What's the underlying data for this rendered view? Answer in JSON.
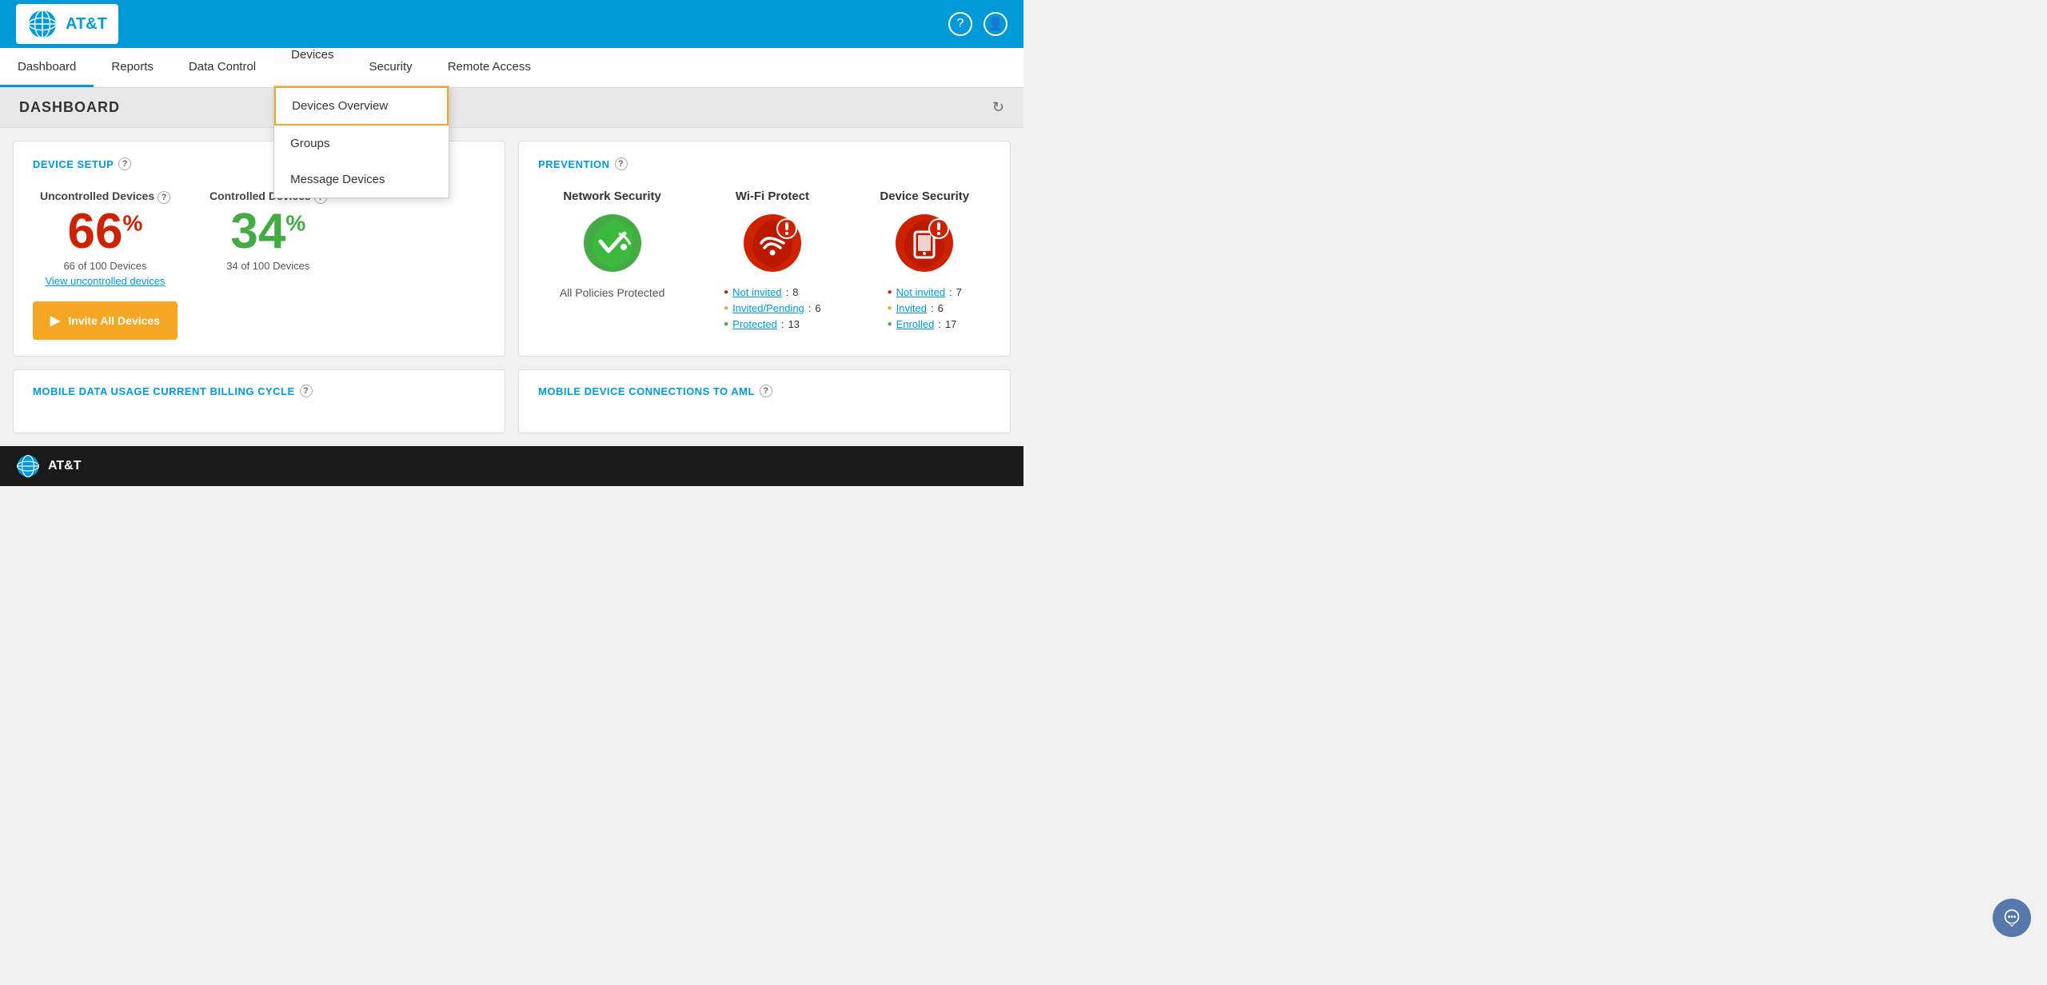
{
  "header": {
    "logo_text": "AT&T",
    "help_icon": "?",
    "user_icon": "👤"
  },
  "nav": {
    "items": [
      {
        "id": "dashboard",
        "label": "Dashboard",
        "active": true
      },
      {
        "id": "reports",
        "label": "Reports",
        "active": false
      },
      {
        "id": "data-control",
        "label": "Data Control",
        "active": false
      },
      {
        "id": "devices",
        "label": "Devices",
        "active": false,
        "open": true
      },
      {
        "id": "security",
        "label": "Security",
        "active": false
      },
      {
        "id": "remote-access",
        "label": "Remote Access",
        "active": false
      }
    ],
    "dropdown": {
      "items": [
        {
          "id": "devices-overview",
          "label": "Devices Overview",
          "highlighted": true
        },
        {
          "id": "groups",
          "label": "Groups"
        },
        {
          "id": "message-devices",
          "label": "Message Devices"
        }
      ]
    }
  },
  "page": {
    "title": "DASHBOARD",
    "refresh_icon": "↻"
  },
  "device_setup_card": {
    "title": "DEVICE SETUP",
    "help": "?",
    "uncontrolled": {
      "label": "Uncontrolled Devices",
      "help": "?",
      "percent": "66",
      "suffix": "%",
      "count": "66 of 100 Devices",
      "link": "View uncontrolled devices"
    },
    "controlled": {
      "label": "Controlled Devices",
      "help": "?",
      "percent": "34",
      "suffix": "%",
      "count": "34 of 100 Devices"
    },
    "invite_button": "Invite All Devices"
  },
  "prevention_card": {
    "title": "PREVENTION",
    "help": "?",
    "columns": [
      {
        "id": "network-security",
        "title": "Network Security",
        "icon_type": "shield-green",
        "status_text": "All Policies Protected",
        "stats": []
      },
      {
        "id": "wifi-protect",
        "title": "Wi-Fi Protect",
        "icon_type": "shield-red",
        "stats": [
          {
            "color": "red",
            "label": "Not invited",
            "value": "8"
          },
          {
            "color": "orange",
            "label": "Invited/Pending",
            "value": "6"
          },
          {
            "color": "green",
            "label": "Protected",
            "value": "13"
          }
        ]
      },
      {
        "id": "device-security",
        "title": "Device Security",
        "icon_type": "shield-red-device",
        "stats": [
          {
            "color": "red",
            "label": "Not invited",
            "value": "7"
          },
          {
            "color": "orange",
            "label": "Invited",
            "value": "6"
          },
          {
            "color": "green",
            "label": "Enrolled",
            "value": "17"
          }
        ]
      }
    ]
  },
  "bottom_cards": [
    {
      "id": "mobile-data",
      "title": "MOBILE DATA USAGE CURRENT BILLING CYCLE",
      "help": "?"
    },
    {
      "id": "mobile-device-connections",
      "title": "MOBILE DEVICE CONNECTIONS TO AML",
      "help": "?"
    }
  ],
  "footer": {
    "logo_text": "AT&T"
  },
  "chat_bubble": "😊"
}
